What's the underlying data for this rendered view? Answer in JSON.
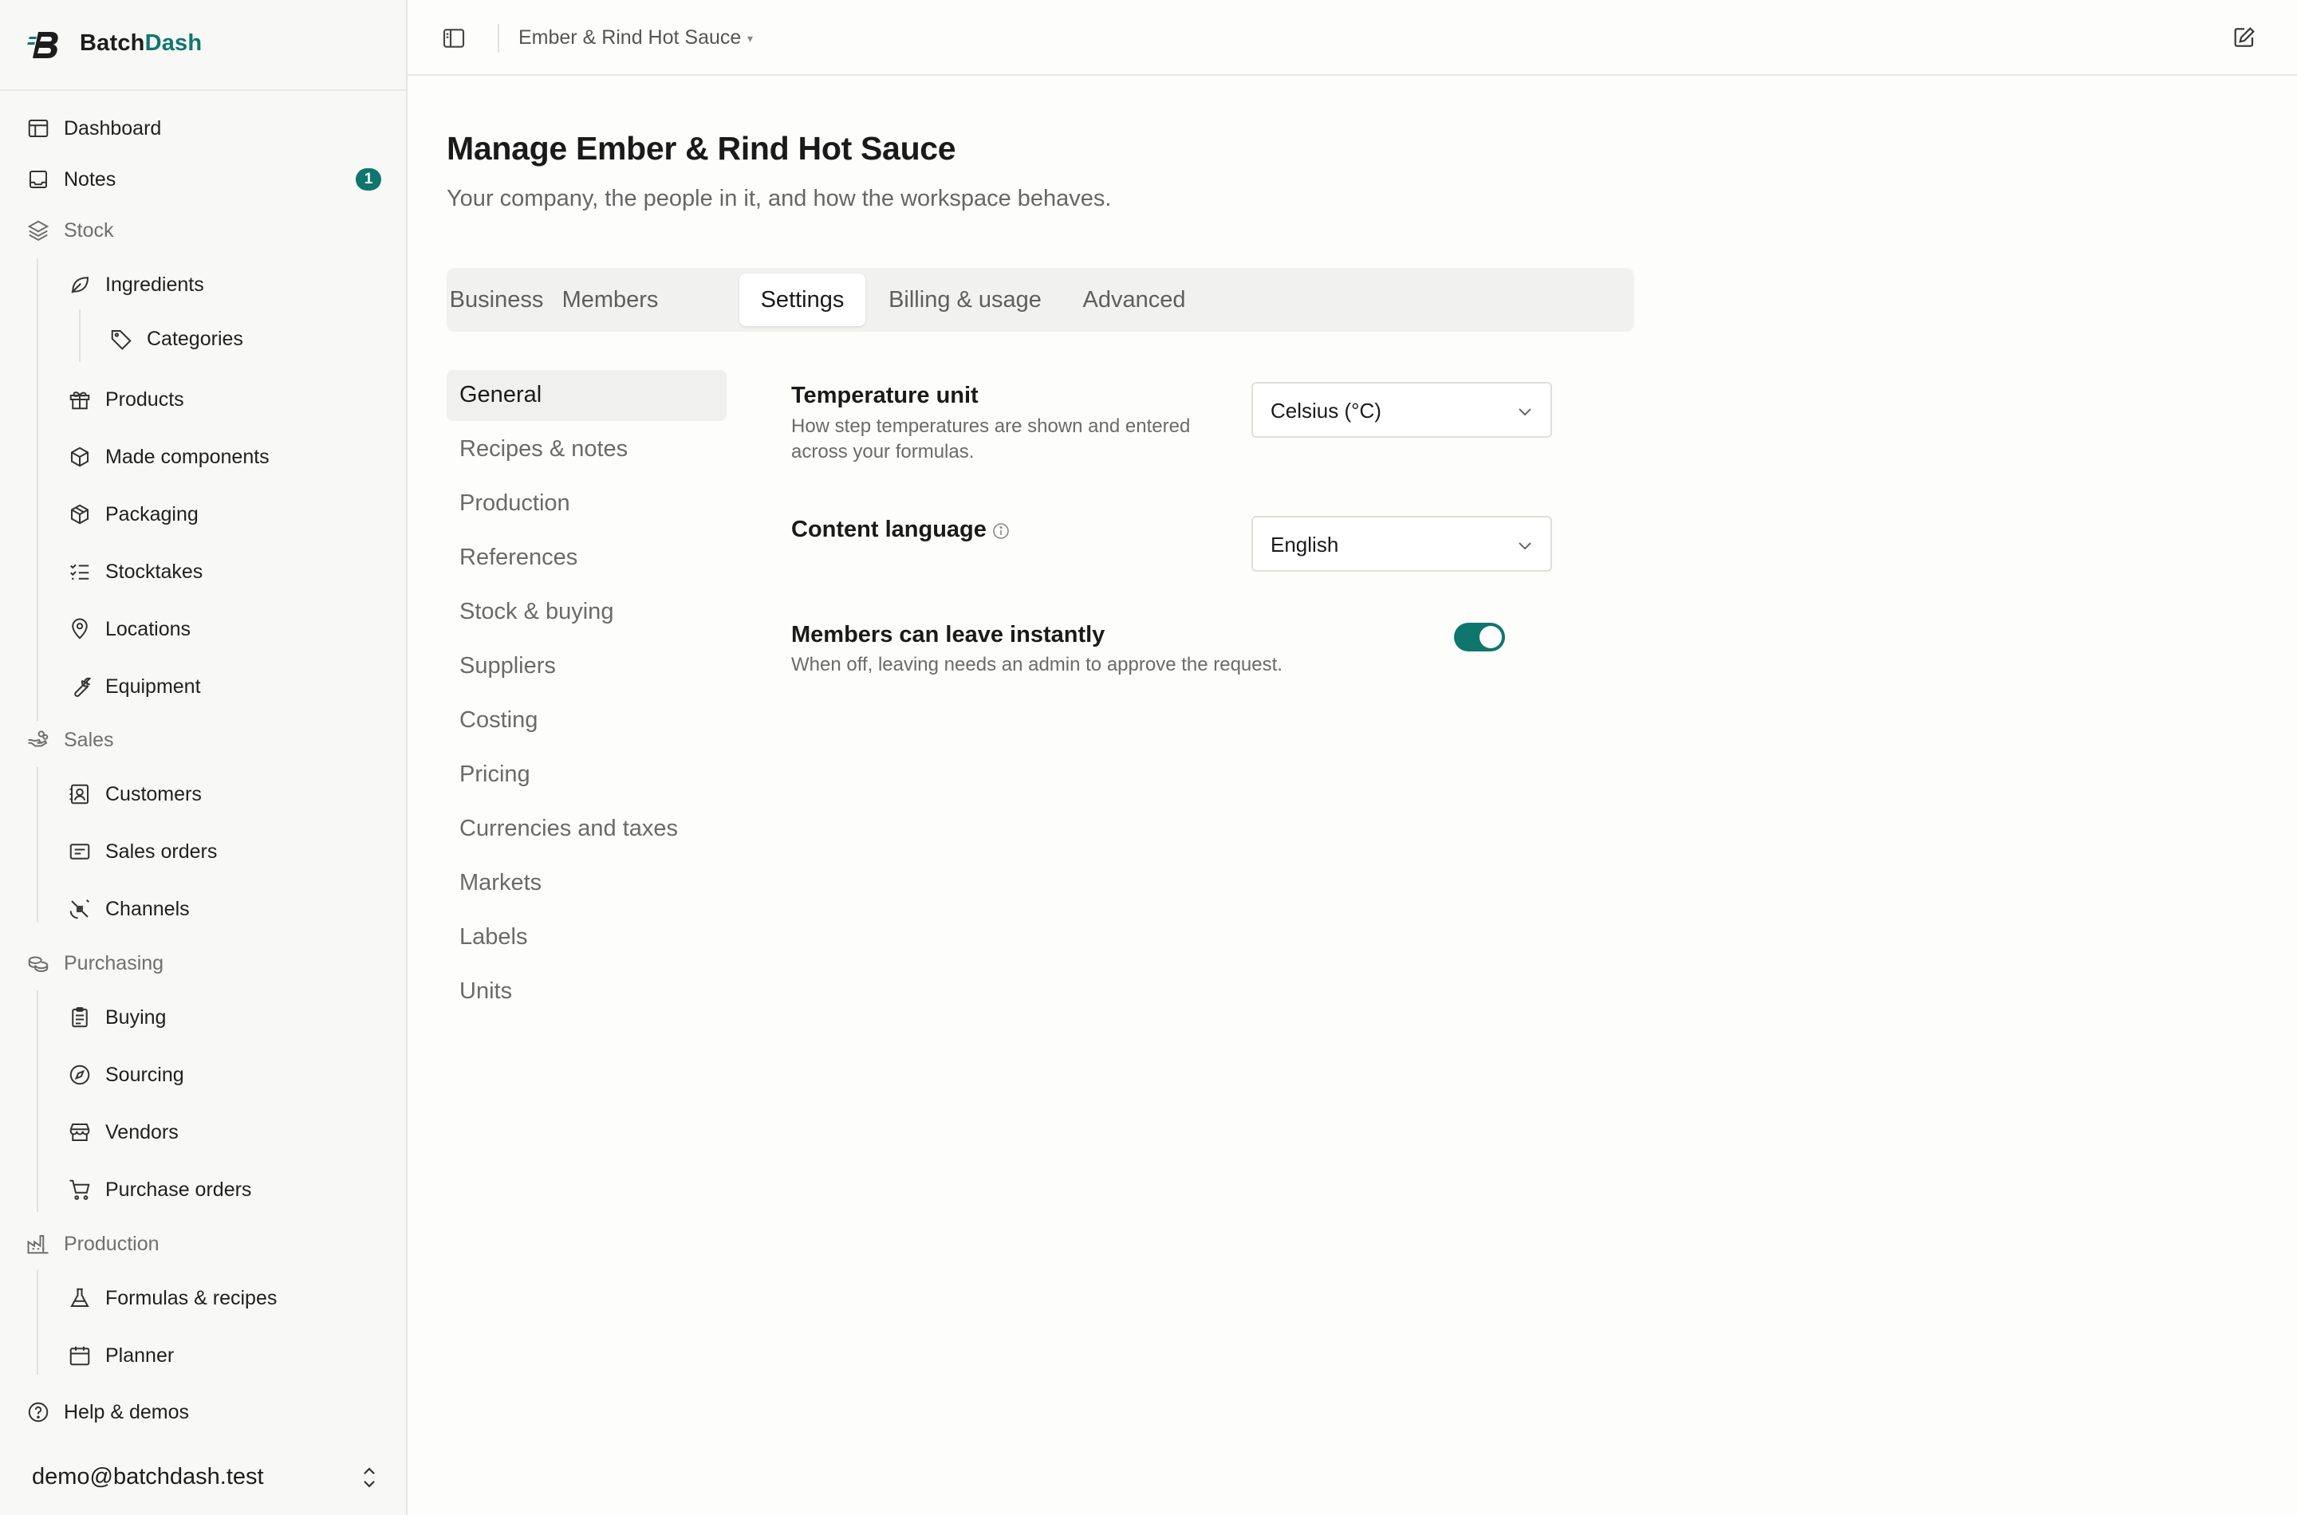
{
  "brand": {
    "name_part1": "Batch",
    "name_part2": "Dash",
    "accent_color": "#0f766e"
  },
  "sidebar": {
    "items": [
      {
        "label": "Dashboard",
        "icon": "layout-dashboard-icon"
      },
      {
        "label": "Notes",
        "icon": "inbox-icon",
        "badge": "1"
      },
      {
        "label": "Stock",
        "icon": "layers-icon"
      },
      {
        "label": "Ingredients",
        "icon": "leaf-icon"
      },
      {
        "label": "Categories",
        "icon": "tag-icon"
      },
      {
        "label": "Products",
        "icon": "gift-icon"
      },
      {
        "label": "Made components",
        "icon": "box-icon"
      },
      {
        "label": "Packaging",
        "icon": "package-icon"
      },
      {
        "label": "Stocktakes",
        "icon": "list-checks-icon"
      },
      {
        "label": "Locations",
        "icon": "map-pin-icon"
      },
      {
        "label": "Equipment",
        "icon": "wrench-icon"
      },
      {
        "label": "Sales",
        "icon": "hand-coins-icon"
      },
      {
        "label": "Customers",
        "icon": "contact-icon"
      },
      {
        "label": "Sales orders",
        "icon": "receipt-icon"
      },
      {
        "label": "Channels",
        "icon": "satellite-icon"
      },
      {
        "label": "Purchasing",
        "icon": "coins-icon"
      },
      {
        "label": "Buying",
        "icon": "clipboard-icon"
      },
      {
        "label": "Sourcing",
        "icon": "compass-icon"
      },
      {
        "label": "Vendors",
        "icon": "store-icon"
      },
      {
        "label": "Purchase orders",
        "icon": "cart-icon"
      },
      {
        "label": "Production",
        "icon": "factory-icon"
      },
      {
        "label": "Formulas & recipes",
        "icon": "flask-icon"
      },
      {
        "label": "Planner",
        "icon": "calendar-icon"
      },
      {
        "label": "Help & demos",
        "icon": "help-circle-icon"
      }
    ],
    "user_email": "demo@batchdash.test"
  },
  "topbar": {
    "workspace": "Ember & Rind Hot Sauce",
    "caret": "▾"
  },
  "main": {
    "title": "Manage Ember & Rind Hot Sauce",
    "subtitle": "Your company, the people in it, and how the workspace behaves.",
    "tabs": [
      {
        "label": "Business"
      },
      {
        "label": "Members"
      },
      {
        "label": "Settings"
      },
      {
        "label": "Billing & usage"
      },
      {
        "label": "Advanced"
      }
    ],
    "active_tab": "Settings",
    "subnav": [
      {
        "label": "General"
      },
      {
        "label": "Recipes & notes"
      },
      {
        "label": "Production"
      },
      {
        "label": "References"
      },
      {
        "label": "Stock & buying"
      },
      {
        "label": "Suppliers"
      },
      {
        "label": "Costing"
      },
      {
        "label": "Pricing"
      },
      {
        "label": "Currencies and taxes"
      },
      {
        "label": "Markets"
      },
      {
        "label": "Labels"
      },
      {
        "label": "Units"
      }
    ],
    "settings": {
      "temperature": {
        "title": "Temperature unit",
        "desc_line1": "How step temperatures are shown and entered",
        "desc_line2": "across your formulas.",
        "value": "Celsius (°C)"
      },
      "language": {
        "title": "Content language",
        "value": "English"
      },
      "leave": {
        "title": "Members can leave instantly",
        "desc": "When off, leaving needs an admin to approve the request.",
        "enabled": true
      }
    }
  }
}
